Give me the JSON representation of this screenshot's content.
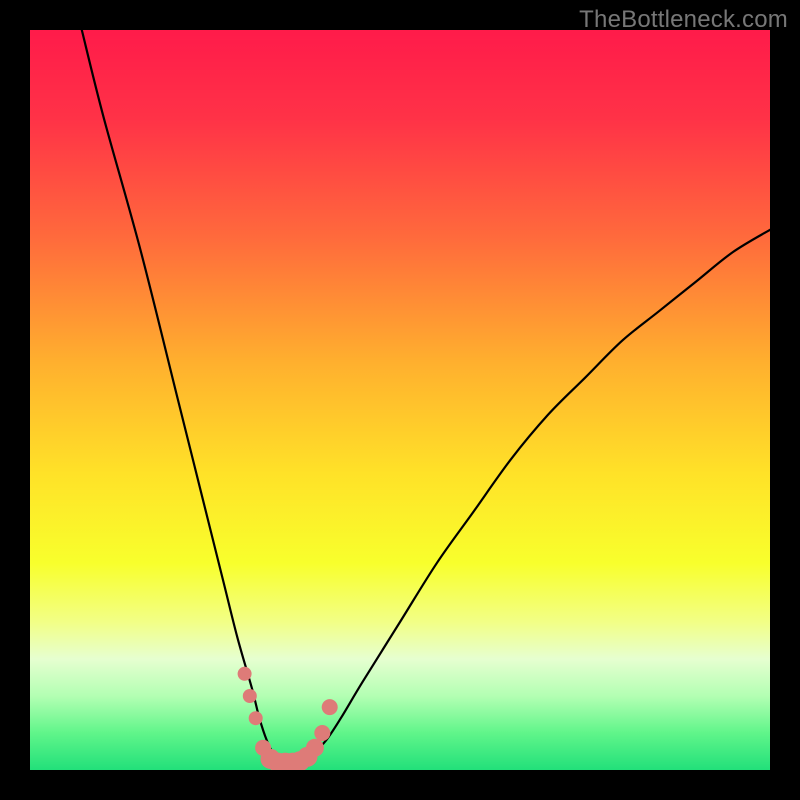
{
  "watermark": "TheBottleneck.com",
  "chart_data": {
    "type": "line",
    "title": "",
    "xlabel": "",
    "ylabel": "",
    "x_range": [
      0,
      100
    ],
    "y_range": [
      0,
      100
    ],
    "grid": false,
    "series": [
      {
        "name": "bottleneck-curve",
        "x": [
          7,
          10,
          15,
          20,
          23,
          26,
          28,
          30,
          31,
          32,
          33,
          34,
          35,
          36,
          38,
          40,
          42,
          45,
          50,
          55,
          60,
          65,
          70,
          75,
          80,
          85,
          90,
          95,
          100
        ],
        "y": [
          100,
          88,
          70,
          50,
          38,
          26,
          18,
          11,
          7,
          4,
          2,
          1,
          1,
          1,
          2,
          4,
          7,
          12,
          20,
          28,
          35,
          42,
          48,
          53,
          58,
          62,
          66,
          70,
          73
        ]
      }
    ],
    "markers": {
      "name": "highlight-dots",
      "color": "#de7b78",
      "x": [
        29.0,
        29.7,
        30.5,
        31.5,
        32.5,
        33.5,
        34.5,
        35.5,
        36.5,
        37.5,
        38.5,
        39.5,
        40.5
      ],
      "y": [
        13.0,
        10.0,
        7.0,
        3.0,
        1.5,
        1.0,
        1.0,
        1.0,
        1.2,
        1.8,
        3.0,
        5.0,
        8.5
      ],
      "r": [
        7,
        7,
        7,
        8,
        10,
        10,
        10,
        10,
        10,
        10,
        9,
        8,
        8
      ]
    },
    "gradient": {
      "stops": [
        {
          "offset": 0.0,
          "color": "#ff1b4a"
        },
        {
          "offset": 0.12,
          "color": "#ff3247"
        },
        {
          "offset": 0.28,
          "color": "#ff6a3c"
        },
        {
          "offset": 0.45,
          "color": "#ffb02e"
        },
        {
          "offset": 0.6,
          "color": "#ffe228"
        },
        {
          "offset": 0.72,
          "color": "#f8ff2c"
        },
        {
          "offset": 0.8,
          "color": "#f2ff86"
        },
        {
          "offset": 0.85,
          "color": "#e6ffd0"
        },
        {
          "offset": 0.9,
          "color": "#b3ffb3"
        },
        {
          "offset": 0.95,
          "color": "#60f58a"
        },
        {
          "offset": 1.0,
          "color": "#22e07a"
        }
      ]
    }
  }
}
